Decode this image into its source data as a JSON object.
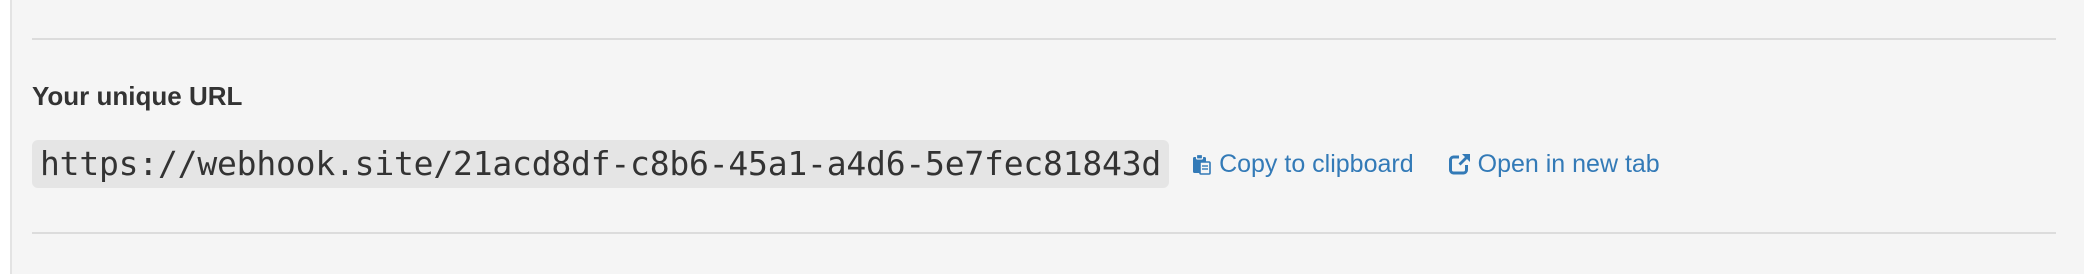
{
  "section": {
    "heading": "Your unique URL",
    "url": "https://webhook.site/21acd8df-c8b6-45a1-a4d6-5e7fec81843d",
    "actions": [
      {
        "label": "Copy to clipboard",
        "icon": "clipboard-icon"
      },
      {
        "label": "Open in new tab",
        "icon": "external-link-icon"
      }
    ]
  },
  "colors": {
    "background": "#f5f5f5",
    "code_background": "#e5e5e5",
    "text": "#333333",
    "link": "#337ab7",
    "divider": "#dcdcdc"
  }
}
